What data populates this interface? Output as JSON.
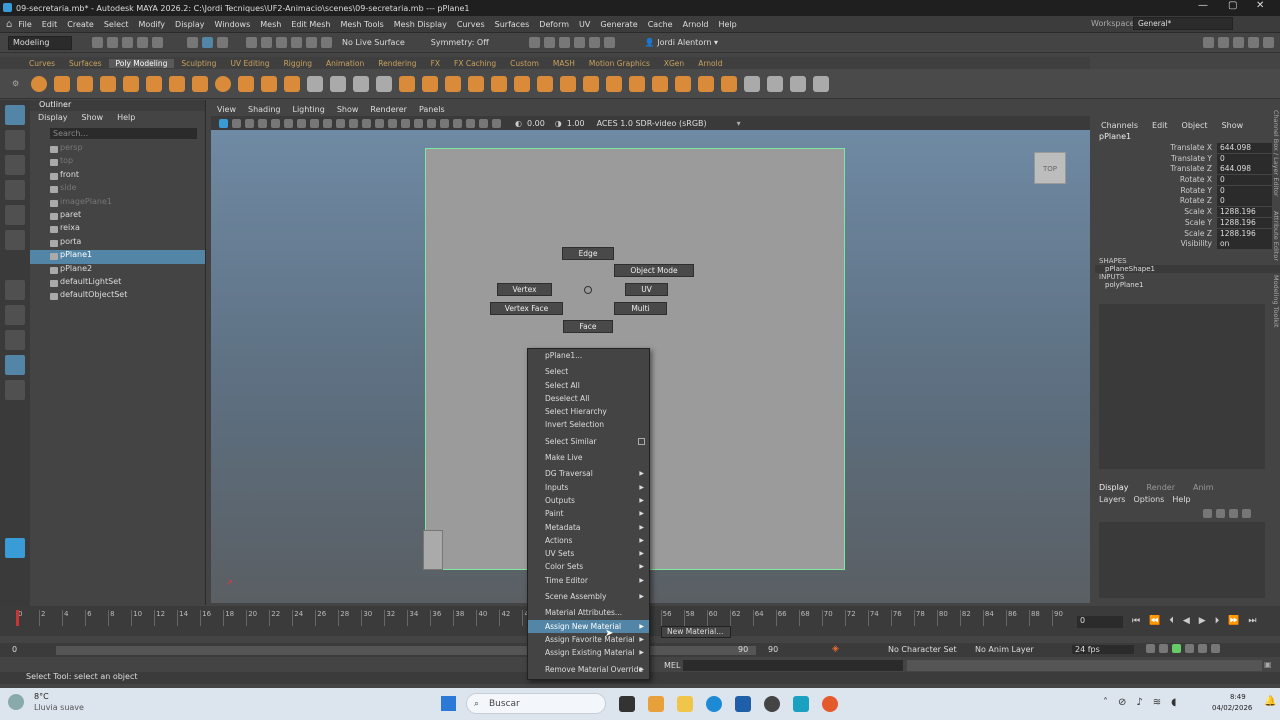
{
  "window": {
    "title": "09-secretaria.mb* - Autodesk MAYA 2026.2: C:\\Jordi Tecniques\\UF2-Animacio\\scenes\\09-secretaria.mb   ---   pPlane1",
    "min": "—",
    "max": "▢",
    "close": "✕"
  },
  "menus": [
    "File",
    "Edit",
    "Create",
    "Select",
    "Modify",
    "Display",
    "Windows",
    "Mesh",
    "Edit Mesh",
    "Mesh Tools",
    "Mesh Display",
    "Curves",
    "Surfaces",
    "Deform",
    "UV",
    "Generate",
    "Cache",
    "Arnold",
    "Help"
  ],
  "workspace": {
    "label": "Workspace:",
    "value": "General*"
  },
  "status": {
    "mode": "Modeling",
    "live_surface": "No Live Surface",
    "symmetry": "Symmetry: Off",
    "user": "Jordi Alentorn"
  },
  "shelf_tabs": [
    "Curves",
    "Surfaces",
    "Poly Modeling",
    "Sculpting",
    "UV Editing",
    "Rigging",
    "Animation",
    "Rendering",
    "FX",
    "FX Caching",
    "Custom",
    "MASH",
    "Motion Graphics",
    "XGen",
    "Arnold"
  ],
  "shelf_active": "Poly Modeling",
  "outliner": {
    "title": "Outliner",
    "menu": [
      "Display",
      "Show",
      "Help"
    ],
    "search_placeholder": "Search...",
    "items": [
      {
        "label": "persp",
        "dim": true
      },
      {
        "label": "top",
        "dim": true
      },
      {
        "label": "front",
        "dim": false
      },
      {
        "label": "side",
        "dim": true
      },
      {
        "label": "imagePlane1",
        "dim": true
      },
      {
        "label": "paret",
        "dim": false
      },
      {
        "label": "reixa",
        "dim": false
      },
      {
        "label": "porta",
        "dim": false
      },
      {
        "label": "pPlane1",
        "dim": false,
        "selected": true
      },
      {
        "label": "pPlane2",
        "dim": false
      },
      {
        "label": "defaultLightSet",
        "dim": false
      },
      {
        "label": "defaultObjectSet",
        "dim": false
      }
    ]
  },
  "viewport": {
    "menu": [
      "View",
      "Shading",
      "Lighting",
      "Show",
      "Renderer",
      "Panels"
    ],
    "exposure": "0.00",
    "gamma": "1.00",
    "colorspace": "ACES 1.0 SDR-video (sRGB)",
    "view_cube": "TOP"
  },
  "marking_menu": {
    "edge": "Edge",
    "object_mode": "Object Mode",
    "vertex": "Vertex",
    "uv": "UV",
    "vertex_face": "Vertex Face",
    "multi": "Multi",
    "face": "Face"
  },
  "context_menu": [
    {
      "label": "pPlane1...",
      "sub": false
    },
    {
      "label": "Select",
      "sub": false,
      "sep": true
    },
    {
      "label": "Select All",
      "sub": false
    },
    {
      "label": "Deselect All",
      "sub": false
    },
    {
      "label": "Select Hierarchy",
      "sub": false
    },
    {
      "label": "Invert Selection",
      "sub": false
    },
    {
      "label": "Select Similar",
      "sub": false,
      "sep": true,
      "box": true
    },
    {
      "label": "Make Live",
      "sub": false,
      "sep": true
    },
    {
      "label": "DG Traversal",
      "sub": true,
      "sep": true
    },
    {
      "label": "Inputs",
      "sub": true
    },
    {
      "label": "Outputs",
      "sub": true
    },
    {
      "label": "Paint",
      "sub": true
    },
    {
      "label": "Metadata",
      "sub": true
    },
    {
      "label": "Actions",
      "sub": true
    },
    {
      "label": "UV Sets",
      "sub": true
    },
    {
      "label": "Color Sets",
      "sub": true
    },
    {
      "label": "Time Editor",
      "sub": true
    },
    {
      "label": "Scene Assembly",
      "sub": true,
      "sep": true
    },
    {
      "label": "Material Attributes...",
      "sub": false,
      "sep": true
    },
    {
      "label": "Assign New Material",
      "sub": true,
      "active": true
    },
    {
      "label": "Assign Favorite Material",
      "sub": true
    },
    {
      "label": "Assign Existing Material",
      "sub": true
    },
    {
      "label": "Remove Material Override",
      "sub": true,
      "sep": true
    }
  ],
  "submenu": {
    "item": "New Material..."
  },
  "channel_box": {
    "menu": [
      "Channels",
      "Edit",
      "Object",
      "Show"
    ],
    "object": "pPlane1",
    "attrs": [
      {
        "name": "Translate X",
        "value": "644.098"
      },
      {
        "name": "Translate Y",
        "value": "0"
      },
      {
        "name": "Translate Z",
        "value": "644.098"
      },
      {
        "name": "Rotate X",
        "value": "0"
      },
      {
        "name": "Rotate Y",
        "value": "0"
      },
      {
        "name": "Rotate Z",
        "value": "0"
      },
      {
        "name": "Scale X",
        "value": "1288.196"
      },
      {
        "name": "Scale Y",
        "value": "1288.196"
      },
      {
        "name": "Scale Z",
        "value": "1288.196"
      },
      {
        "name": "Visibility",
        "value": "on"
      }
    ],
    "shapes_label": "SHAPES",
    "shape": "pPlaneShape1",
    "inputs_label": "INPUTS",
    "input": "polyPlane1",
    "layer_tabs": [
      "Display",
      "Render",
      "Anim"
    ],
    "layer_menu": [
      "Layers",
      "Options",
      "Help"
    ]
  },
  "side_tabs": [
    "Channel Box / Layer Editor",
    "Attribute Editor",
    "Modeling Toolkit"
  ],
  "timeline": {
    "ticks": [
      "0",
      "2",
      "4",
      "6",
      "8",
      "10",
      "12",
      "14",
      "16",
      "18",
      "20",
      "22",
      "24",
      "26",
      "28",
      "30",
      "32",
      "34",
      "36",
      "38",
      "40",
      "42",
      "44",
      "46",
      "48",
      "50",
      "52",
      "54",
      "56",
      "58",
      "60",
      "62",
      "64",
      "66",
      "68",
      "70",
      "72",
      "74",
      "76",
      "78",
      "80",
      "82",
      "84",
      "86",
      "88",
      "90"
    ],
    "current": "0",
    "range_start": "0",
    "range_start2": "0",
    "range_end": "90",
    "range_end2": "90",
    "char_set": "No Character Set",
    "anim_layer": "No Anim Layer",
    "fps": "24 fps"
  },
  "command": {
    "lang": "MEL"
  },
  "help": "Select Tool: select an object",
  "taskbar": {
    "temp": "8°C",
    "weather": "Lluvia suave",
    "search": "Buscar",
    "time": "8:49",
    "date": "04/02/2026"
  }
}
